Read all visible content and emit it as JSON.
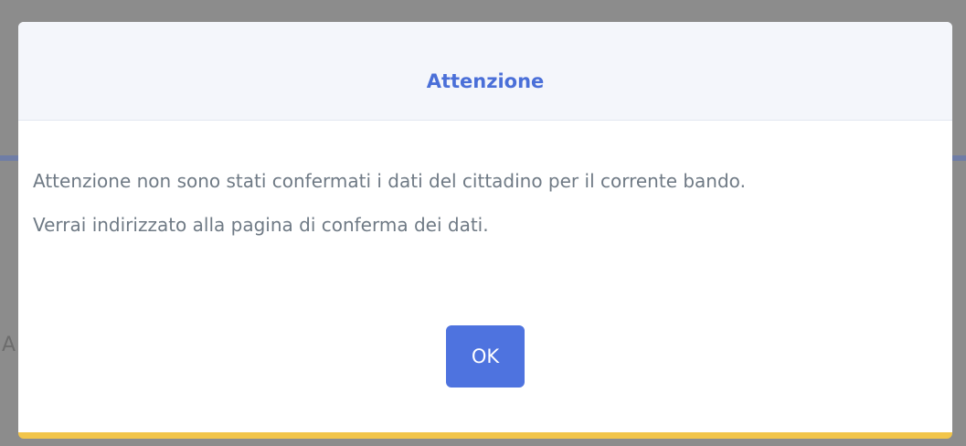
{
  "dialog": {
    "title": "Attenzione",
    "message_line1": "Attenzione non sono stati confermati i dati del cittadino per il corrente bando.",
    "message_line2": "Verrai indirizzato alla pagina di conferma dei dati.",
    "ok_label": "OK"
  },
  "colors": {
    "title": "#4a6fd8",
    "button": "#4e73df",
    "bottom_border": "#f2c54a",
    "overlay": "#8c8c8c"
  }
}
